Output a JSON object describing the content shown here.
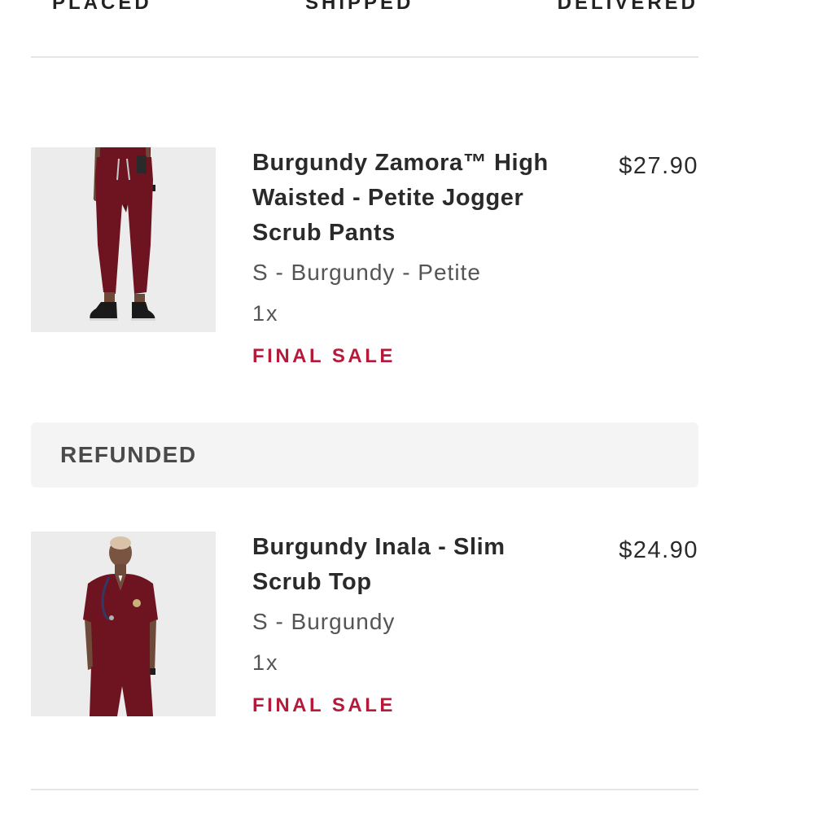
{
  "order_progress": {
    "steps": [
      "PLACED",
      "SHIPPED",
      "DELIVERED"
    ]
  },
  "items": [
    {
      "name": "Burgundy Zamora™ High Waisted - Petite Jogger Scrub Pants",
      "price": "$27.90",
      "variant": "S - Burgundy - Petite",
      "quantity": "1x",
      "sale_label": "FINAL SALE",
      "image_icon": "jogger-pants-photo"
    },
    {
      "name": "Burgundy Inala - Slim Scrub Top",
      "price": "$24.90",
      "variant": "S - Burgundy",
      "quantity": "1x",
      "sale_label": "FINAL SALE",
      "image_icon": "scrub-top-photo"
    }
  ],
  "refund_section": {
    "label": "REFUNDED"
  },
  "colors": {
    "sale_accent": "#b51a3b",
    "product_burgundy": "#6e1420",
    "section_background": "#f4f4f4"
  }
}
